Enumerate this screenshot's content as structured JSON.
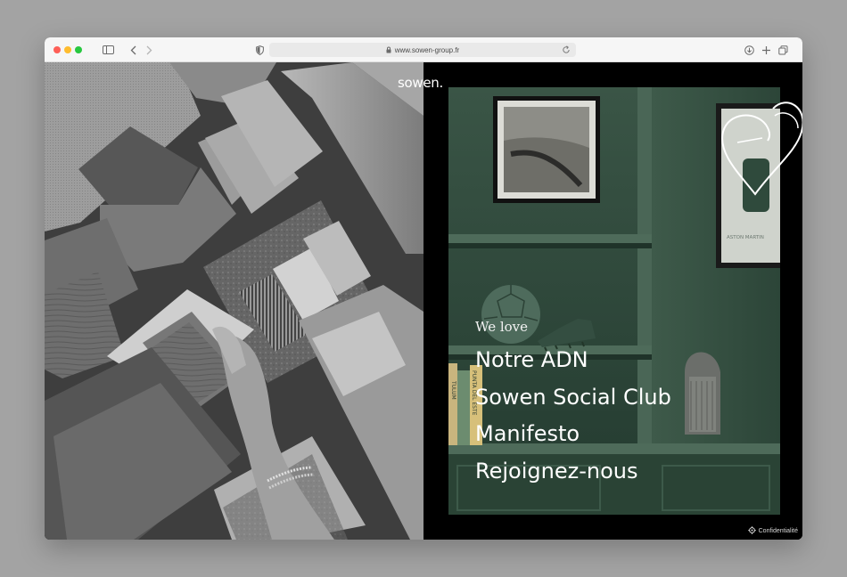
{
  "browser": {
    "url": "www.sowen-group.fr"
  },
  "site": {
    "logo": "sowen.",
    "kicker": "We love",
    "menu": [
      {
        "label": "Notre ADN"
      },
      {
        "label": "Sowen Social Club"
      },
      {
        "label": "Manifesto"
      },
      {
        "label": "Rejoignez-nous"
      }
    ],
    "privacy_label": "Confidentialité",
    "poster_text": "ASTON MARTIN",
    "book_spines": [
      "TULUM",
      "PUNTA DEL ESTE"
    ]
  },
  "colors": {
    "room_green": "#2d4438",
    "text": "#ffffff"
  },
  "icons": [
    "sidebar-icon",
    "back-icon",
    "forward-icon",
    "shield-icon",
    "lock-icon",
    "reload-icon",
    "download-icon",
    "new-tab-icon",
    "tabs-icon",
    "gear-icon",
    "heart-doodle-icon"
  ]
}
